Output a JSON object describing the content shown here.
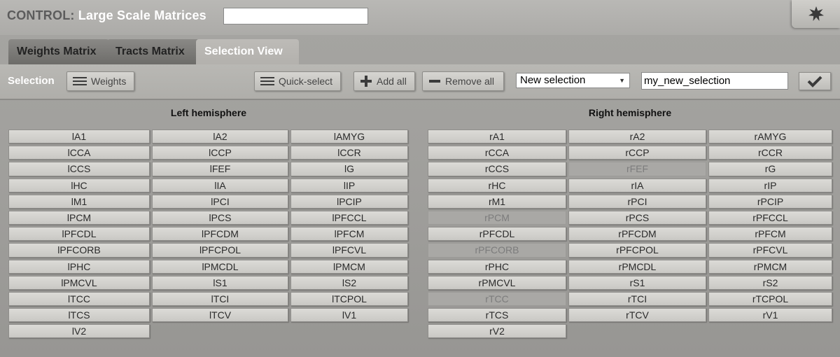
{
  "header": {
    "title_prefix": "CONTROL:",
    "title": "Large Scale Matrices",
    "corner_icon": "star-icon"
  },
  "tabs": [
    {
      "label": "Weights Matrix",
      "active": false
    },
    {
      "label": "Tracts Matrix",
      "active": false
    },
    {
      "label": "Selection View",
      "active": true
    }
  ],
  "toolbar": {
    "selection_label": "Selection",
    "weights_button": "Weights",
    "quick_select_button": "Quick-select",
    "add_all_button": "Add all",
    "remove_all_button": "Remove all",
    "selection_dropdown": "New selection",
    "selection_name": "my_new_selection",
    "confirm_icon": "check-icon"
  },
  "left": {
    "title": "Left hemisphere",
    "regions": [
      "lA1",
      "lA2",
      "lAMYG",
      "lCCA",
      "lCCP",
      "lCCR",
      "lCCS",
      "lFEF",
      "lG",
      "lHC",
      "lIA",
      "lIP",
      "lM1",
      "lPCI",
      "lPCIP",
      "lPCM",
      "lPCS",
      "lPFCCL",
      "lPFCDL",
      "lPFCDM",
      "lPFCM",
      "lPFCORB",
      "lPFCPOL",
      "lPFCVL",
      "lPHC",
      "lPMCDL",
      "lPMCM",
      "lPMCVL",
      "lS1",
      "lS2",
      "lTCC",
      "lTCI",
      "lTCPOL",
      "lTCS",
      "lTCV",
      "lV1",
      "lV2"
    ]
  },
  "right": {
    "title": "Right hemisphere",
    "regions": [
      "rA1",
      "rA2",
      "rAMYG",
      "rCCA",
      "rCCP",
      "rCCR",
      "rCCS",
      "rFEF",
      "rG",
      "rHC",
      "rIA",
      "rIP",
      "rM1",
      "rPCI",
      "rPCIP",
      "rPCM",
      "rPCS",
      "rPFCCL",
      "rPFCDL",
      "rPFCDM",
      "rPFCM",
      "rPFCORB",
      "rPFCPOL",
      "rPFCVL",
      "rPHC",
      "rPMCDL",
      "rPMCM",
      "rPMCVL",
      "rS1",
      "rS2",
      "rTCC",
      "rTCI",
      "rTCPOL",
      "rTCS",
      "rTCV",
      "rV1",
      "rV2"
    ],
    "disabled": [
      "rFEF",
      "rPCM",
      "rPFCORB",
      "rTCC"
    ]
  }
}
